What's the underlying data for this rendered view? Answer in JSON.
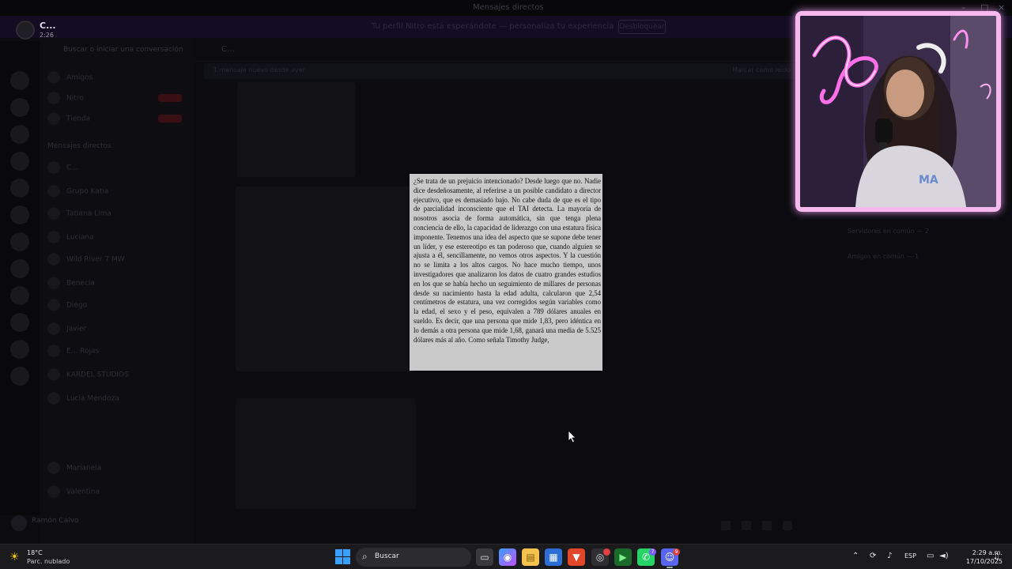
{
  "window": {
    "title": "Mensajes directos"
  },
  "banner": {
    "text": "Tu perfil Nitro está esperándote — personaliza tu experiencia",
    "button": "Desbloquear"
  },
  "call": {
    "name": "C...",
    "time": "2:26"
  },
  "channels": {
    "search_placeholder": "Buscar o iniciar una conversación",
    "items": [
      "Amigos",
      "Nitro",
      "Tienda",
      "Mensajes directos",
      "C...",
      "Grupo Katia",
      "Tatiana Lima",
      "Luciana",
      "Wild River 7 MW",
      "Benecia",
      "Diego",
      "Javier",
      "E... Rojas",
      "KARDEL STUDIOS",
      "Lucía Mendoza",
      "Marianela",
      "Valentina"
    ]
  },
  "user": {
    "name": "Ramón Calvo"
  },
  "chat": {
    "header": "C...",
    "pinned": "1 mensaje nuevo desde ayer",
    "pinned_action": "Marcar como leído"
  },
  "right_panel": {
    "rows": [
      "Servidores en común — 2",
      "Amigos en común — 1"
    ]
  },
  "book_page": {
    "text": "¿Se trata de un prejuicio intencionado? Desde luego que no. Nadie dice desdeñosamente, al referirse a un posible candidato a director ejecutivo, que es demasiado bajo. No cabe duda de que es el tipo de parcialidad inconsciente que el TAI detecta. La mayoría de nosotros asocia de forma automática, sin que tenga plena conciencia de ello, la capacidad de liderazgo con una estatura física imponente. Tenemos una idea del aspecto que se supone debe tener un líder, y ese estereotipo es tan poderoso que, cuando alguien se ajusta a él, sencillamente, no vemos otros aspectos. Y la cuestión no se limita a los altos cargos. No hace mucho tiempo, unos investigadores que analizaron los datos de cuatro grandes estudios en los que se había hecho un seguimiento de millares de personas desde su nacimiento hasta la edad adulta, calcularon que 2,54 centímetros de estatura, una vez corregidos según variables como la edad, el sexo y el peso, equivalen a 789 dólares anuales en sueldo. Es decir, que una persona que mide 1,83, pero idéntica en lo demás a otra persona que mide 1,68, ganará una media de 5.525 dólares más al año. Como señala Timothy Judge,"
  },
  "taskbar": {
    "weather_temp": "18°C",
    "weather_cond": "Parc. nublado",
    "search_placeholder": "Buscar",
    "language": "ESP",
    "time": "2:29 a.m.",
    "date": "17/10/2025",
    "whatsapp_badge": "7",
    "discord_badge": "9"
  },
  "colors": {
    "webcam_border": "#f5b9ee",
    "taskbar": "#1b1b1d",
    "accent": "#3aa0ff"
  }
}
